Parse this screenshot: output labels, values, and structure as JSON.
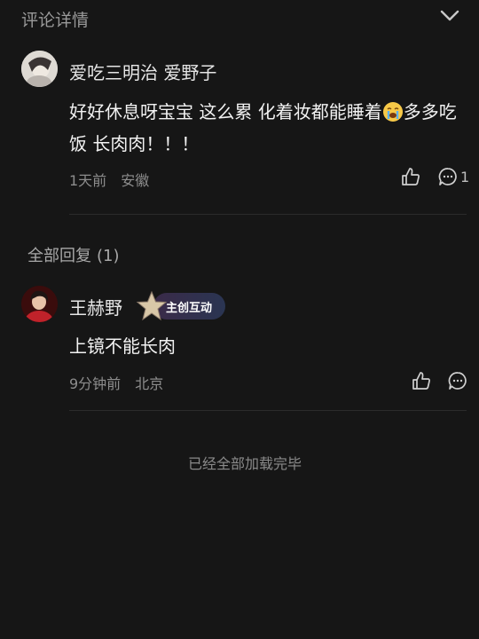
{
  "header": {
    "title": "评论详情"
  },
  "comment": {
    "author": "爱吃三明治  爱野子",
    "text_before_emoji": "好好休息呀宝宝 这么累 化着妆都能睡着",
    "emoji": "crying-face-emoji",
    "text_after_emoji": "多多吃饭 长肉肉！！！",
    "time": "1天前",
    "location": "安徽",
    "comment_count": "1"
  },
  "replies_section": {
    "label": "全部回复",
    "count": "(1)"
  },
  "reply": {
    "author": "王赫野",
    "badge": "主创互动",
    "text": "上镜不能长肉",
    "time": "9分钟前",
    "location": "北京"
  },
  "footer": {
    "text": "已经全部加载完毕"
  },
  "colors": {
    "background": "#161616",
    "text": "#f2f2f2",
    "muted": "#8d8d8d"
  },
  "icons": [
    "chevron-down-icon",
    "like-icon",
    "comment-icon",
    "star-badge-icon"
  ]
}
